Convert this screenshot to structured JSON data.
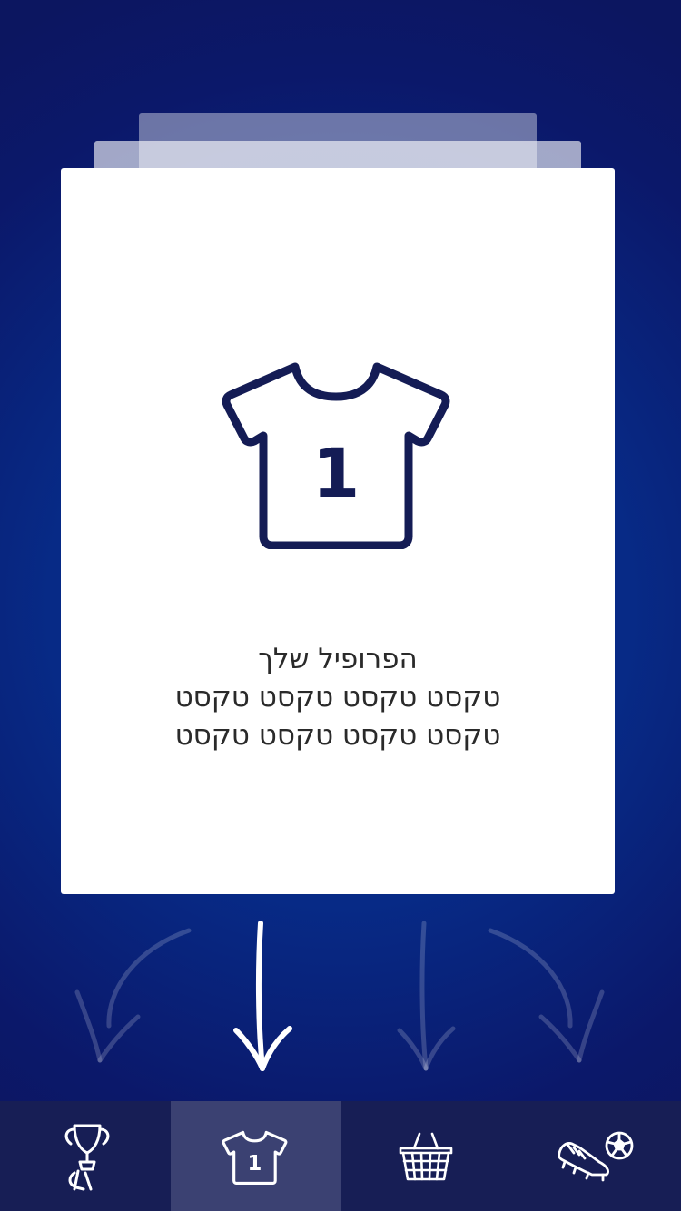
{
  "card": {
    "title": "הפרופיל שלך",
    "line1": "טקסט טקסט טקסט טקסט",
    "line2": "טקסט טקסט טקסט טקסט",
    "shirt_number": "1",
    "icon": "jersey-icon"
  },
  "tabs": [
    {
      "icon": "trophy-icon",
      "active": false
    },
    {
      "icon": "jersey-icon",
      "label": "1",
      "active": true
    },
    {
      "icon": "basket-icon",
      "active": false
    },
    {
      "icon": "cleats-ball-icon",
      "active": false
    }
  ],
  "colors": {
    "background": "#072a86",
    "card": "#ffffff",
    "icon_navy": "#141c55",
    "tabbar": "#171e55",
    "tab_active": "#3b4172"
  }
}
